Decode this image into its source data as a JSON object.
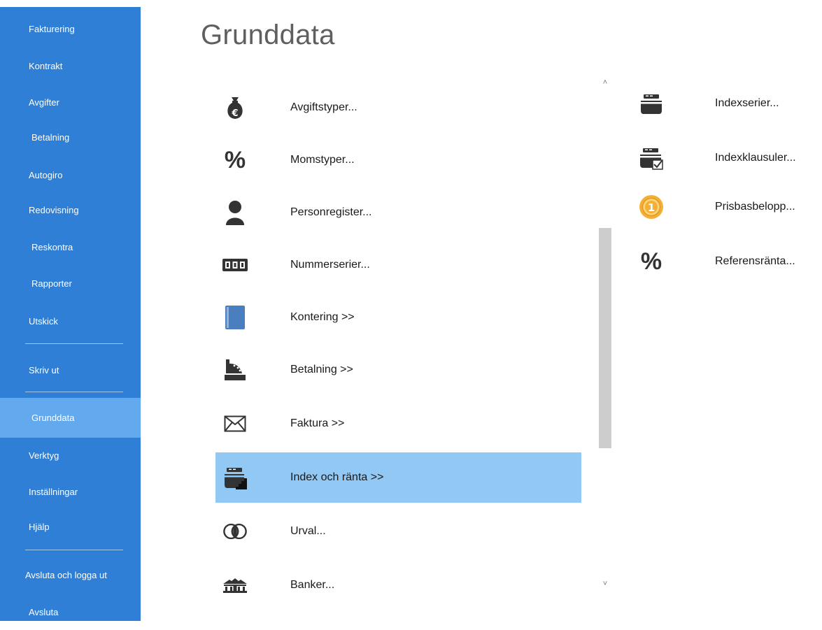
{
  "sidebar": {
    "items": [
      {
        "label": "Fakturering"
      },
      {
        "label": "Kontrakt"
      },
      {
        "label": "Avgifter"
      },
      {
        "label": "Betalning"
      },
      {
        "label": "Autogiro"
      },
      {
        "label": "Redovisning"
      },
      {
        "label": "Reskontra"
      },
      {
        "label": "Rapporter"
      },
      {
        "label": "Utskick"
      },
      {
        "label": "Skriv ut"
      },
      {
        "label": "Grunddata"
      },
      {
        "label": "Verktyg"
      },
      {
        "label": "Inställningar"
      },
      {
        "label": "Hjälp"
      },
      {
        "label": "Avsluta och logga ut"
      },
      {
        "label": "Avsluta"
      }
    ],
    "active": "Grunddata"
  },
  "page": {
    "title": "Grunddata"
  },
  "main_list": [
    {
      "label": "Avgiftstyper...",
      "icon": "money-bag-euro-icon"
    },
    {
      "label": "Momstyper...",
      "icon": "percent-icon"
    },
    {
      "label": "Personregister...",
      "icon": "person-icon"
    },
    {
      "label": "Nummerserier...",
      "icon": "number-series-icon"
    },
    {
      "label": "Kontering >>",
      "icon": "ledger-book-icon"
    },
    {
      "label": "Betalning >>",
      "icon": "cash-register-icon"
    },
    {
      "label": "Faktura >>",
      "icon": "envelope-icon"
    },
    {
      "label": "Index och ränta >>",
      "icon": "index-stairs-icon",
      "selected": true
    },
    {
      "label": "Urval...",
      "icon": "intersect-circles-icon"
    },
    {
      "label": "Banker...",
      "icon": "bank-icon"
    }
  ],
  "right_list": [
    {
      "label": "Indexserier...",
      "icon": "index-series-icon"
    },
    {
      "label": "Indexklausuler...",
      "icon": "index-clause-icon"
    },
    {
      "label": "Prisbasbelopp...",
      "icon": "coin-icon"
    },
    {
      "label": "Referensränta...",
      "icon": "percent-icon"
    }
  ],
  "scrollbar": {
    "up": "˄",
    "down": "˅"
  },
  "colors": {
    "sidebar": "#2f7fd6",
    "sidebar_active": "#63a9ee",
    "selected_row": "#92c8f4",
    "coin": "#f2b134"
  }
}
